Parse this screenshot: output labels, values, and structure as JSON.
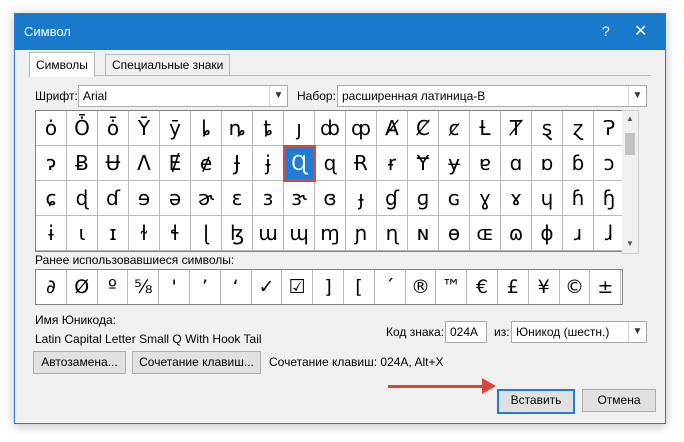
{
  "window": {
    "title": "Символ",
    "help": "?",
    "close": "✕"
  },
  "tabs": [
    {
      "label": "Символы"
    },
    {
      "label": "Специальные знаки"
    }
  ],
  "font": {
    "label": "Шрифт:",
    "value": "Arial"
  },
  "subset": {
    "label": "Набор:",
    "value": "расширенная латиница-B"
  },
  "symbols": {
    "rows": [
      [
        "ȯ",
        "Ȱ",
        "ȱ",
        "Ȳ",
        "ȳ",
        "ȴ",
        "ȵ",
        "ȶ",
        "ȷ",
        "ȸ",
        "ȹ",
        "Ⱥ",
        "Ȼ",
        "ȼ",
        "Ƚ",
        "Ⱦ",
        "ȿ",
        "ɀ",
        "Ɂ"
      ],
      [
        "ɂ",
        "Ƀ",
        "Ʉ",
        "Ʌ",
        "Ɇ",
        "ɇ",
        "Ɉ",
        "ɉ",
        "Ɋ",
        "ɋ",
        "Ɍ",
        "ɍ",
        "Ɏ",
        "ɏ",
        "ɐ",
        "ɑ",
        "ɒ",
        "ɓ",
        "ɔ"
      ],
      [
        "ɕ",
        "ɖ",
        "ɗ",
        "ɘ",
        "ə",
        "ɚ",
        "ɛ",
        "ɜ",
        "ɝ",
        "ɞ",
        "ɟ",
        "ɠ",
        "ɡ",
        "ɢ",
        "ɣ",
        "ɤ",
        "ɥ",
        "ɦ",
        "ɧ"
      ],
      [
        "ɨ",
        "ɩ",
        "ɪ",
        "ɫ",
        "ɬ",
        "ɭ",
        "ɮ",
        "ɯ",
        "ɰ",
        "ɱ",
        "ɲ",
        "ɳ",
        "ɴ",
        "ɵ",
        "ɶ",
        "ɷ",
        "ɸ",
        "ɹ",
        "ɺ"
      ]
    ],
    "selected_row": 1,
    "selected_col": 8
  },
  "recent": {
    "label": "Ранее использовавшиеся символы:",
    "items": [
      "∂",
      "Ø",
      "º",
      "⅝",
      "'",
      "’",
      "‘",
      "✓",
      "☑",
      "]",
      "[",
      "´",
      "®",
      "™",
      "€",
      "£",
      "¥",
      "©",
      "±"
    ]
  },
  "unicode_name": {
    "label": "Имя Юникода:",
    "value": "Latin Capital Letter Small Q With Hook Tail"
  },
  "char_code": {
    "label": "Код знака:",
    "value": "024A"
  },
  "from": {
    "label": "из:",
    "value": "Юникод (шестн.)"
  },
  "buttons": {
    "autocorrect": "Автозамена...",
    "shortcut": "Сочетание клавиш...",
    "shortcut_info": "Сочетание клавиш: 024A, Alt+X",
    "insert": "Вставить",
    "cancel": "Отмена"
  },
  "colors": {
    "titlebar": "#1979ca",
    "selection": "#1f7bd4",
    "highlight": "#d9463c"
  }
}
